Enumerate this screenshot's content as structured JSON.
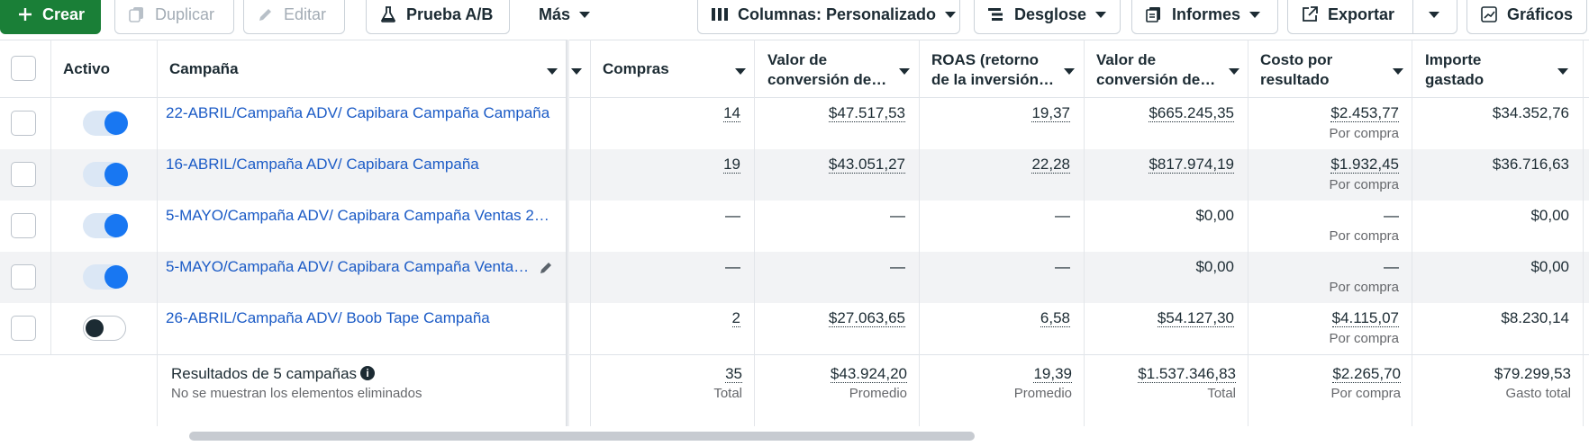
{
  "toolbar": {
    "create": "Crear",
    "duplicate": "Duplicar",
    "edit": "Editar",
    "ab_test": "Prueba A/B",
    "more": "Más",
    "columns": "Columnas: Personalizado",
    "breakdown": "Desglose",
    "reports": "Informes",
    "export": "Exportar",
    "charts": "Gráficos"
  },
  "headers": {
    "active": "Activo",
    "campaign": "Campaña",
    "purchases": "Compras",
    "conv_value_1": [
      "Valor de",
      "conversión de…"
    ],
    "roas": [
      "ROAS (retorno",
      "de la inversión…"
    ],
    "conv_value_2": [
      "Valor de",
      "conversión de…"
    ],
    "cost_per_result": [
      "Costo por",
      "resultado"
    ],
    "amount_spent": [
      "Importe",
      "gastado"
    ]
  },
  "rows": [
    {
      "active": true,
      "campaign": "22-ABRIL/Campaña ADV/ Capibara Campaña Campaña",
      "purchases": "14",
      "conv_value_1": "$47.517,53",
      "roas": "19,37",
      "conv_value_2": "$665.245,35",
      "cost_per_result": "$2.453,77",
      "cost_sub": "Por compra",
      "spent": "$34.352,76"
    },
    {
      "active": true,
      "campaign": "16-ABRIL/Campaña ADV/ Capibara Campaña",
      "purchases": "19",
      "conv_value_1": "$43.051,27",
      "roas": "22,28",
      "conv_value_2": "$817.974,19",
      "cost_per_result": "$1.932,45",
      "cost_sub": "Por compra",
      "spent": "$36.716,63"
    },
    {
      "active": true,
      "campaign": "5-MAYO/Campaña ADV/ Capibara Campaña Ventas 2 …",
      "purchases": "—",
      "conv_value_1": "—",
      "roas": "—",
      "conv_value_2": "$0,00",
      "cost_per_result": "—",
      "cost_sub": "Por compra",
      "spent": "$0,00"
    },
    {
      "active": true,
      "campaign": "5-MAYO/Campaña ADV/ Capibara Campaña Ventas…",
      "purchases": "—",
      "conv_value_1": "—",
      "roas": "—",
      "conv_value_2": "$0,00",
      "cost_per_result": "—",
      "cost_sub": "Por compra",
      "spent": "$0,00"
    },
    {
      "active": false,
      "campaign": "26-ABRIL/Campaña ADV/ Boob Tape Campaña",
      "purchases": "2",
      "conv_value_1": "$27.063,65",
      "roas": "6,58",
      "conv_value_2": "$54.127,30",
      "cost_per_result": "$4.115,07",
      "cost_sub": "Por compra",
      "spent": "$8.230,14"
    }
  ],
  "footer": {
    "title": "Resultados de 5 campañas",
    "subtitle": "No se muestran los elementos eliminados",
    "purchases": "35",
    "purchases_sub": "Total",
    "conv_value_1": "$43.924,20",
    "conv_value_1_sub": "Promedio",
    "roas": "19,39",
    "roas_sub": "Promedio",
    "conv_value_2": "$1.537.346,83",
    "conv_value_2_sub": "Total",
    "cost_per_result": "$2.265,70",
    "cost_sub": "Por compra",
    "spent": "$79.299,53",
    "spent_sub": "Gasto total"
  },
  "colors": {
    "create": "#1a7f37",
    "link": "#1b5bc6",
    "toggle_on": "#1877f2"
  }
}
